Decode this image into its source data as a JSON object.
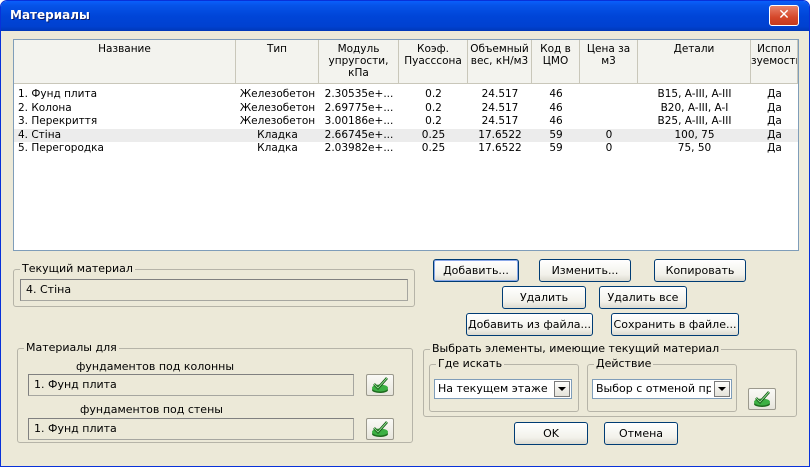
{
  "window": {
    "title": "Материалы",
    "close_glyph": "✕"
  },
  "table": {
    "headers": [
      "Название",
      "Тип",
      "Модуль\nупругости,\nкПа",
      "Коэф.\nПуассcона",
      "Объемный\nвес, кН/м3",
      "Код в\nЦМО",
      "Цена за\nм3",
      "Детали",
      "Испол\nзуемость"
    ],
    "rows": [
      [
        "1. Фунд плита",
        "Железобетон",
        "2.30535e+...",
        "0.2",
        "24.517",
        "46",
        "",
        "B15, A-III, A-III",
        "Да"
      ],
      [
        "2. Колона",
        "Железобетон",
        "2.69775e+...",
        "0.2",
        "24.517",
        "46",
        "",
        "B20, A-III, A-I",
        "Да"
      ],
      [
        "3. Перекриття",
        "Железобетон",
        "3.00186e+...",
        "0.2",
        "24.517",
        "46",
        "",
        "B25, A-III, A-III",
        "Да"
      ],
      [
        "4. Стіна",
        "Кладка",
        "2.66745e+...",
        "0.25",
        "17.6522",
        "59",
        "0",
        "100, 75",
        "Да"
      ],
      [
        "5. Перегородка",
        "Кладка",
        "2.03982e+...",
        "0.25",
        "17.6522",
        "59",
        "0",
        "75, 50",
        "Да"
      ]
    ],
    "selected_row": 3
  },
  "current_material": {
    "label": "Текущий материал",
    "value": "4. Стіна"
  },
  "buttons": {
    "add": "Добавить...",
    "edit": "Изменить...",
    "copy": "Копировать",
    "delete": "Удалить",
    "delete_all": "Удалить все",
    "add_from_file": "Добавить из файла...",
    "save_to_file": "Сохранить в файле...",
    "ok": "OK",
    "cancel": "Отмена"
  },
  "materials_for": {
    "label": "Материалы для",
    "columns_label": "фундаментов под колонны",
    "columns_value": "1. Фунд плита",
    "walls_label": "фундаментов под стены",
    "walls_value": "1. Фунд плита"
  },
  "select_elements": {
    "label": "Выбрать элементы, имеющие текущий материал",
    "where_label": "Где искать",
    "where_value": "На текущем этаже",
    "action_label": "Действие",
    "action_value": "Выбор с отменой предыдущего"
  },
  "colors": {
    "title_blue": "#0045d8",
    "dialog_bg": "#ece9d8",
    "check_green": "#2aa52a"
  }
}
